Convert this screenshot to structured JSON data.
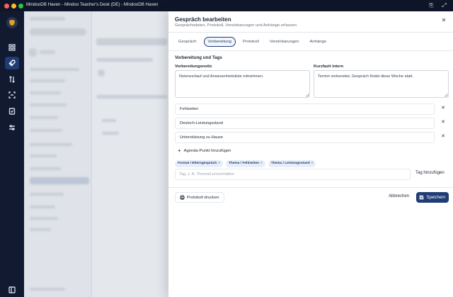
{
  "window": {
    "title": "MindooDB Haven - Mindoo Teacher's Desk (DE) - MindooDB Haven"
  },
  "dialog": {
    "title": "Gespräch bearbeiten",
    "subtitle": "Gesprächsdaten, Protokoll, Vereinbarungen und Anhänge erfassen",
    "tabs": [
      {
        "label": "Gespräch",
        "active": false
      },
      {
        "label": "Vorbereitung",
        "active": true
      },
      {
        "label": "Protokoll",
        "active": false
      },
      {
        "label": "Vereinbarungen",
        "active": false
      },
      {
        "label": "Anhänge",
        "active": false
      }
    ],
    "section_title": "Vorbereitung und Tags",
    "prep_note": {
      "label": "Vorbereitungsnotiz",
      "value": "Notenverlauf und Anwesenheitsliste mitnehmen."
    },
    "summary": {
      "label": "Kurzfazit intern",
      "value": "Termin vorbereitet, Gespräch findet diese Woche statt."
    },
    "agenda_items": [
      "Fehlzeiten",
      "Deutsch-Leistungsstand",
      "Unterstützung zu Hause"
    ],
    "add_agenda_label": "Agenda-Punkt hinzufügen",
    "tags": [
      "Format / Elterngespräch",
      "Thema / Fehlzeiten",
      "Thema / Leistungsstand"
    ],
    "tag_input_placeholder": "Tag, z. B. Thema/Lernverhalten",
    "tag_add_label": "Tag hinzufügen",
    "print_label": "Protokoll drucken",
    "cancel_label": "Abbrechen",
    "save_label": "Speichern"
  },
  "colors": {
    "accent": "#1f3c74",
    "rail": "#111a30",
    "chip_bg": "#e8eef8"
  }
}
